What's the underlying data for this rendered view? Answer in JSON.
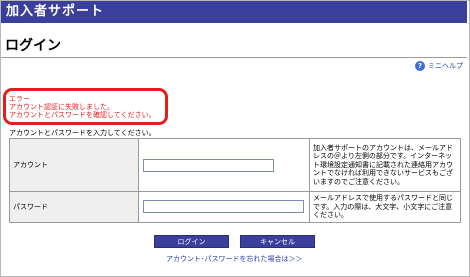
{
  "header": {
    "title": "加入者サポート"
  },
  "page": {
    "title": "ログイン"
  },
  "help": {
    "label": "ミニヘルプ",
    "icon": "question-icon"
  },
  "error": {
    "heading": "エラー",
    "line1": "アカウント認証に失敗しました。",
    "line2": "アカウントとパスワードを確認してください。"
  },
  "instruction": "アカウントとパスワードを入力してください。",
  "form": {
    "account": {
      "label": "アカウント",
      "value": "",
      "note": "加入者サポートのアカウントは、メールアドレスの＠より左側の部分です。インターネット環境設定通知書に記載された連絡用アカウントでなければ利用できないサービスもございますのでご注意ください。"
    },
    "password": {
      "label": "パスワード",
      "value": "",
      "note": "メールアドレスで使用するパスワードと同じです。入力の際は、大文字、小文字にご注意ください。"
    }
  },
  "buttons": {
    "login": "ログイン",
    "cancel": "キャンセル"
  },
  "links": {
    "forgot": "アカウント･パスワードを忘れた場合は＞＞"
  },
  "colors": {
    "header": "#3a3f9c",
    "error": "#e41e1e",
    "link": "#2a3bb0"
  }
}
